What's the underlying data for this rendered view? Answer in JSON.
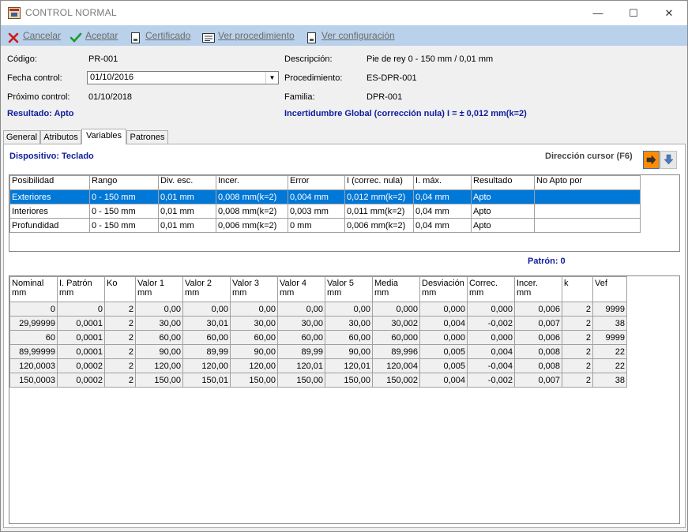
{
  "window": {
    "title": "CONTROL NORMAL",
    "minimize": "—",
    "maximize": "☐",
    "close": "✕"
  },
  "toolbar": {
    "cancel": "Cancelar",
    "accept": "Aceptar",
    "certificate": "Certificado",
    "view_procedure": "Ver procedimiento",
    "view_config": "Ver configuración"
  },
  "header": {
    "codigo_label": "Código:",
    "codigo_value": "PR-001",
    "fecha_label": "Fecha control:",
    "fecha_value": "01/10/2016",
    "proximo_label": "Próximo control:",
    "proximo_value": "01/10/2018",
    "resultado": "Resultado: Apto",
    "descripcion_label": "Descripción:",
    "descripcion_value": "Pie de rey 0 - 150 mm / 0,01 mm",
    "procedimiento_label": "Procedimiento:",
    "procedimiento_value": "ES-DPR-001",
    "familia_label": "Familia:",
    "familia_value": "DPR-001",
    "incertidumbre": "Incertidumbre Global (corrección nula) I = ± 0,012 mm(k=2)"
  },
  "tabs": [
    "General",
    "Atributos",
    "Variables",
    "Patrones"
  ],
  "active_tab": "Variables",
  "dispositivo": "Dispositivo: Teclado",
  "direccion_cursor": "Dirección cursor (F6)",
  "patron": "Patrón: 0",
  "grid1": {
    "columns": [
      "Posibilidad",
      "Rango",
      "Div. esc.",
      "Incer.",
      "Error",
      "I (correc. nula)",
      "I. máx.",
      "Resultado",
      "No Apto por"
    ],
    "rows": [
      [
        "Exteriores",
        "0 - 150 mm",
        "0,01 mm",
        "0,008 mm(k=2)",
        "0,004 mm",
        "0,012 mm(k=2)",
        "0,04 mm",
        "Apto",
        ""
      ],
      [
        "Interiores",
        "0 - 150 mm",
        "0,01 mm",
        "0,008 mm(k=2)",
        "0,003 mm",
        "0,011 mm(k=2)",
        "0,04 mm",
        "Apto",
        ""
      ],
      [
        "Profundidad",
        "0 - 150 mm",
        "0,01 mm",
        "0,006 mm(k=2)",
        "0 mm",
        "0,006 mm(k=2)",
        "0,04 mm",
        "Apto",
        ""
      ]
    ]
  },
  "grid2": {
    "columns": [
      {
        "l1": "Nominal",
        "l2": "mm"
      },
      {
        "l1": "I. Patrón",
        "l2": "mm"
      },
      {
        "l1": "Ko",
        "l2": ""
      },
      {
        "l1": "Valor 1",
        "l2": "mm"
      },
      {
        "l1": "Valor 2",
        "l2": "mm"
      },
      {
        "l1": "Valor 3",
        "l2": "mm"
      },
      {
        "l1": "Valor 4",
        "l2": "mm"
      },
      {
        "l1": "Valor 5",
        "l2": "mm"
      },
      {
        "l1": "Media",
        "l2": "mm"
      },
      {
        "l1": "Desviación",
        "l2": "mm"
      },
      {
        "l1": "Correc.",
        "l2": "mm"
      },
      {
        "l1": "Incer.",
        "l2": "mm"
      },
      {
        "l1": "k",
        "l2": ""
      },
      {
        "l1": "Vef",
        "l2": ""
      }
    ],
    "rows": [
      [
        "0",
        "0",
        "2",
        "0,00",
        "0,00",
        "0,00",
        "0,00",
        "0,00",
        "0,000",
        "0,000",
        "0,000",
        "0,006",
        "2",
        "9999"
      ],
      [
        "29,99999",
        "0,0001",
        "2",
        "30,00",
        "30,01",
        "30,00",
        "30,00",
        "30,00",
        "30,002",
        "0,004",
        "-0,002",
        "0,007",
        "2",
        "38"
      ],
      [
        "60",
        "0,0001",
        "2",
        "60,00",
        "60,00",
        "60,00",
        "60,00",
        "60,00",
        "60,000",
        "0,000",
        "0,000",
        "0,006",
        "2",
        "9999"
      ],
      [
        "89,99999",
        "0,0001",
        "2",
        "90,00",
        "89,99",
        "90,00",
        "89,99",
        "90,00",
        "89,996",
        "0,005",
        "0,004",
        "0,008",
        "2",
        "22"
      ],
      [
        "120,0003",
        "0,0002",
        "2",
        "120,00",
        "120,00",
        "120,00",
        "120,01",
        "120,01",
        "120,004",
        "0,005",
        "-0,004",
        "0,008",
        "2",
        "22"
      ],
      [
        "150,0003",
        "0,0002",
        "2",
        "150,00",
        "150,01",
        "150,00",
        "150,00",
        "150,00",
        "150,002",
        "0,004",
        "-0,002",
        "0,007",
        "2",
        "38"
      ]
    ]
  },
  "colors": {
    "selection": "#0078d7",
    "toolbar": "#b9d1ea",
    "accent_text": "#0f1d9e",
    "dir_button_active": "#ff8c00"
  }
}
